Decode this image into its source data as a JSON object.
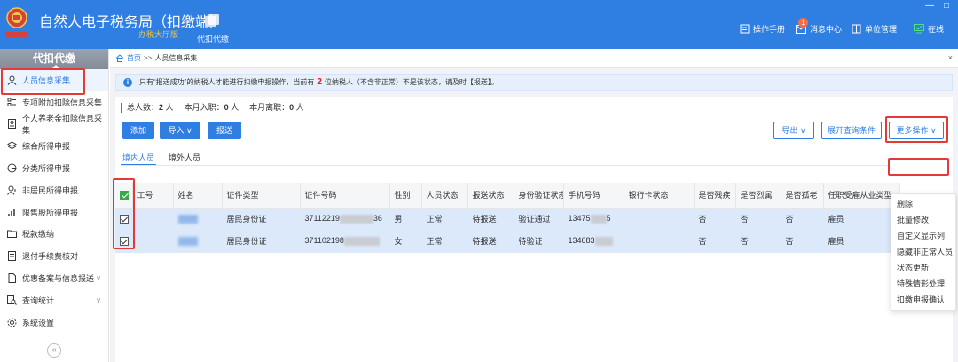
{
  "header": {
    "title": "自然人电子税务局（扣缴端）",
    "subtitle": "办税大厅版",
    "module": "代扣代缴",
    "manual": "操作手册",
    "messages": "消息中心",
    "message_count": "1",
    "unit_mgmt": "单位管理",
    "online": "在线"
  },
  "sidebar": {
    "header": "代扣代缴",
    "items": [
      {
        "label": "人员信息采集"
      },
      {
        "label": "专项附加扣除信息采集"
      },
      {
        "label": "个人养老金扣除信息采集"
      },
      {
        "label": "综合所得申报"
      },
      {
        "label": "分类所得申报"
      },
      {
        "label": "非居民所得申报"
      },
      {
        "label": "限售股所得申报"
      },
      {
        "label": "税款缴纳"
      },
      {
        "label": "退付手续费核对"
      },
      {
        "label": "优惠备案与信息报送"
      },
      {
        "label": "查询统计"
      },
      {
        "label": "系统设置"
      }
    ],
    "collapse": "«"
  },
  "breadcrumb": {
    "home": "首页",
    "sep": ">>",
    "current": "人员信息采集",
    "close": "×"
  },
  "notice": {
    "icon": "i",
    "text_before": "只有“报送成功”的纳税人才能进行扣缴申报操作，当前有",
    "count": "2",
    "text_after": "位纳税人（不含非正常）不是该状态，请及时【报送】。"
  },
  "stats": {
    "total_label": "总人数：",
    "total": "2",
    "total_unit": "人",
    "join_label": "本月入职：",
    "join": "0",
    "join_unit": "人",
    "leave_label": "本月离职：",
    "leave": "0",
    "leave_unit": "人"
  },
  "toolbar": {
    "add": "添加",
    "import": "导入",
    "submit": "报送",
    "export": "导出",
    "expand_query": "展开查询条件",
    "more": "更多操作"
  },
  "tabs": [
    "境内人员",
    "境外人员"
  ],
  "table": {
    "columns": [
      "",
      "工号",
      "姓名",
      "证件类型",
      "证件号码",
      "性别",
      "人员状态",
      "报送状态",
      "身份验证状态",
      "手机号码",
      "银行卡状态",
      "是否残疾",
      "是否烈属",
      "是否孤老",
      "任职受雇从业类型"
    ],
    "rows": [
      {
        "id_type": "居民身份证",
        "id_prefix": "37112219",
        "id_suffix": "36",
        "gender": "男",
        "status": "正常",
        "report": "待报送",
        "verify": "验证通过",
        "phone_prefix": "13475",
        "phone_suffix": "5",
        "disabled": "否",
        "martyr": "否",
        "orphan": "否",
        "employ": "雇员"
      },
      {
        "id_type": "居民身份证",
        "id_prefix": "371102198",
        "id_suffix": "",
        "gender": "女",
        "status": "正常",
        "report": "待报送",
        "verify": "待验证",
        "phone_prefix": "134683",
        "phone_suffix": "",
        "disabled": "否",
        "martyr": "否",
        "orphan": "否",
        "employ": "雇员"
      }
    ]
  },
  "more_menu": [
    "删除",
    "批量修改",
    "自定义显示列",
    "隐藏非正常人员",
    "状态更新",
    "特殊情形处理",
    "扣缴申报确认"
  ],
  "colors": {
    "primary": "#2f7fe3",
    "highlight": "#e53935",
    "danger": "#e02020"
  }
}
